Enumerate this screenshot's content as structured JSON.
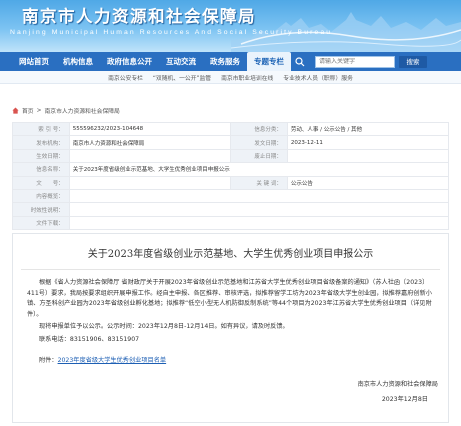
{
  "header": {
    "title": "南京市人力资源和社会保障局",
    "subtitle": "Nanjing Municipal Human Resources And Social Security Bureau"
  },
  "nav": {
    "items": [
      {
        "label": "网站首页"
      },
      {
        "label": "机构信息"
      },
      {
        "label": "政府信息公开"
      },
      {
        "label": "互动交流"
      },
      {
        "label": "政务服务"
      },
      {
        "label": "专题专栏"
      }
    ],
    "active_index": 5,
    "search_placeholder": "请输入关键字",
    "search_button": "搜索"
  },
  "sublinks": [
    "南京公安专栏",
    "“双随机、一公开”监管",
    "南京市职业培训在线",
    "专业技术人员（职称）服务"
  ],
  "breadcrumb": {
    "home": "首页",
    "sep": ">",
    "current": "南京市人力资源和社会保障局"
  },
  "info_table": {
    "rows": [
      {
        "l1": "索 引 号：",
        "v1": "555596232/2023-104648",
        "l2": "信息分类：",
        "v2": "劳动、人事 / 公示公告 / 其他"
      },
      {
        "l1": "发布机构：",
        "v1": "南京市人力资源和社会保障局",
        "l2": "发文日期：",
        "v2": "2023-12-11"
      },
      {
        "l1": "生效日期：",
        "v1": "",
        "l2": "废止日期：",
        "v2": ""
      },
      {
        "l1": "信息名称：",
        "v1": "关于2023年度省级创业示范基地、大学生优秀创业项目申报公示",
        "l2": "",
        "v2": ""
      },
      {
        "l1": "文　　号：",
        "v1": "",
        "l2": "关 键 词：",
        "v2": "公示公告"
      },
      {
        "l1": "内容概览：",
        "v1": "",
        "l2": "",
        "v2": ""
      },
      {
        "l1": "时效性说明：",
        "v1": "",
        "l2": "",
        "v2": ""
      },
      {
        "l1": "文件下载：",
        "v1": "",
        "l2": "",
        "v2": ""
      }
    ]
  },
  "article": {
    "title": "关于2023年度省级创业示范基地、大学生优秀创业项目申报公示",
    "p1": "根据《省人力资源社会保障厅 省财政厅关于开展2023年省级创业示范基地和江苏省大学生优秀创业项目省级备案的通知》（苏人社函〔2023〕411号）要求，我局按要求组织开展申报工作。经自主申报、各区推荐、审核评选，拟推荐留学工坊为2023年省级大学生创业园，拟推荐嘉府创新小镇、方圣科创产业园为2023年省级创业孵化基地；拟推荐“低空小型无人机防御反制系统”等44个项目为2023年江苏省大学生优秀创业项目（详见附件）。",
    "p2": "现将申报单位予以公示。公示时间：2023年12月8日-12月14日。如有异议，请及时反馈。",
    "p3": "联系电话：83151906、83151907",
    "attach_label": "附件：",
    "attach_link": "2023年度省级大学生优秀创业项目名单",
    "sign": "南京市人力资源和社会保障局",
    "date": "2023年12月8日"
  },
  "colors": {
    "header_blue": "#4fa8e6",
    "nav_blue": "#2a6fc1",
    "link_blue": "#1d5fb4"
  }
}
